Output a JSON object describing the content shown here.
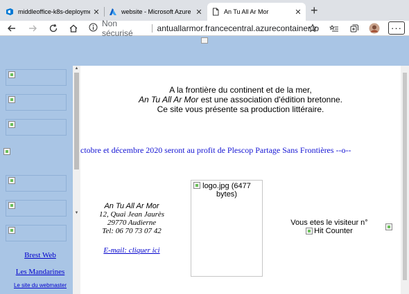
{
  "browser": {
    "tabs": [
      {
        "title": "middleoffice-k8s-deployment",
        "icon": "devops-icon"
      },
      {
        "title": "website - Microsoft Azure",
        "icon": "azure-icon"
      },
      {
        "title": "An Tu All Ar Mor",
        "icon": "page-icon",
        "active": true
      }
    ],
    "address": {
      "security": "Non sécurisé",
      "url": "antuallarmor.francecentral.azurecontainer.io"
    }
  },
  "page": {
    "intro_line1": "A la frontière du continent et de la mer,",
    "intro_line2_italic": "An Tu All Ar Mor",
    "intro_line2_rest": " est une association d'édition bretonne.",
    "intro_line3": "Ce site vous présente sa production littéraire.",
    "marquee": "ctobre et décembre 2020 seront au profit de Plescop Partage Sans Frontières --o--",
    "address": {
      "name": "An Tu All Ar Mor",
      "street": "12, Quai Jean Jaurès",
      "city": "29770 Audierne",
      "tel": "Tel: 06 70 73 07 42",
      "email_link": "E-mail: cliquer ici"
    },
    "logo_alt": "logo.jpg (6477 bytes)",
    "visitor_label": "Vous etes le visiteur n°",
    "counter_alt": "Hit Counter",
    "left_links": [
      "Brest Web",
      "Les Mandarines",
      "Le site du webmaster"
    ]
  }
}
